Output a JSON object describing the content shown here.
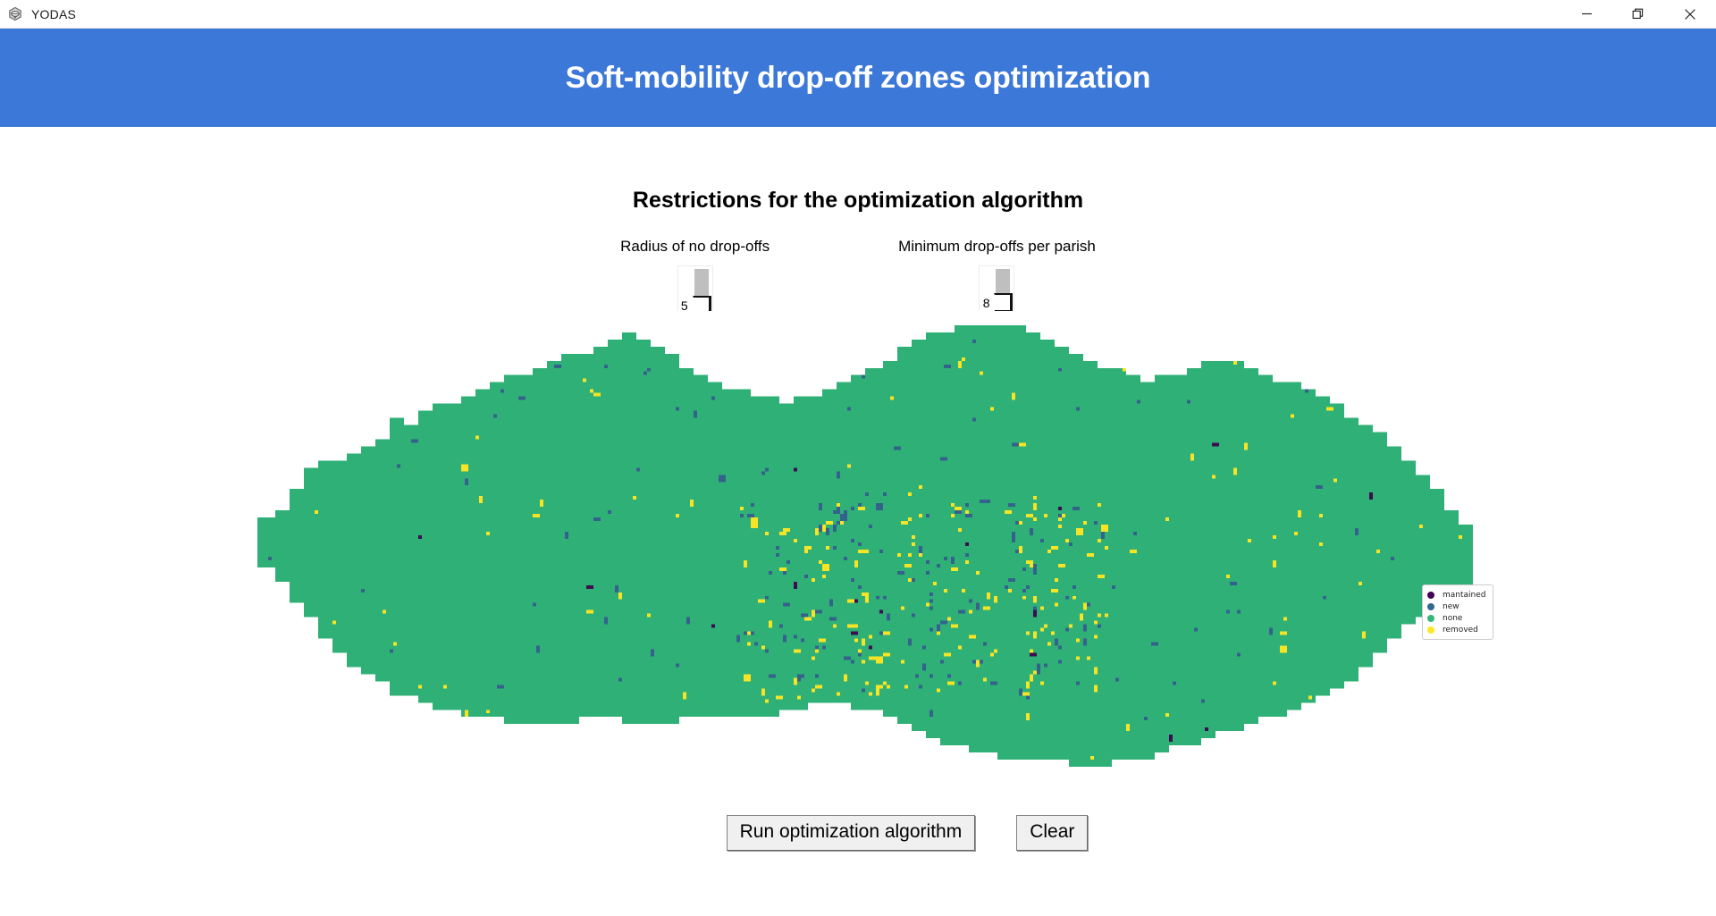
{
  "window": {
    "app_title": "YODAS",
    "app_icon": "turtle-logo-icon",
    "minimize_label": "—",
    "maximize_label": "❐",
    "close_label": "✕"
  },
  "banner": {
    "title": "Soft-mobility drop-off zones optimization",
    "background_color": "#3c78d8",
    "text_color": "#ffffff"
  },
  "main": {
    "section_title": "Restrictions for the optimization algorithm"
  },
  "sliders": [
    {
      "name": "radius-of-no-dropoffs",
      "label": "Radius of no drop-offs",
      "value": "5",
      "thumb_position_pct": 52
    },
    {
      "name": "minimum-dropoffs-per-parish",
      "label": "Minimum drop-offs per parish",
      "value": "8",
      "thumb_position_pct": 46
    }
  ],
  "legend": {
    "title": "",
    "position": "top-right",
    "items": [
      {
        "label": "mantained",
        "color": "#440154"
      },
      {
        "label": "new",
        "color": "#31688e"
      },
      {
        "label": "none",
        "color": "#35b779"
      },
      {
        "label": "removed",
        "color": "#fde725"
      }
    ]
  },
  "map": {
    "type": "choropleth-raster",
    "description": "Pixelated regional map of drop-off zones",
    "colors": {
      "background": "#ffffff",
      "none": "#2fb077",
      "new": "#35628d",
      "removed": "#f7e425",
      "mantained": "#3d0d52"
    },
    "counts": {
      "new": 205,
      "removed": 243,
      "mantained": 17
    }
  },
  "buttons": [
    {
      "name": "run-optimization-algorithm-button",
      "label": "Run optimization algorithm"
    },
    {
      "name": "clear-button",
      "label": "Clear"
    }
  ]
}
